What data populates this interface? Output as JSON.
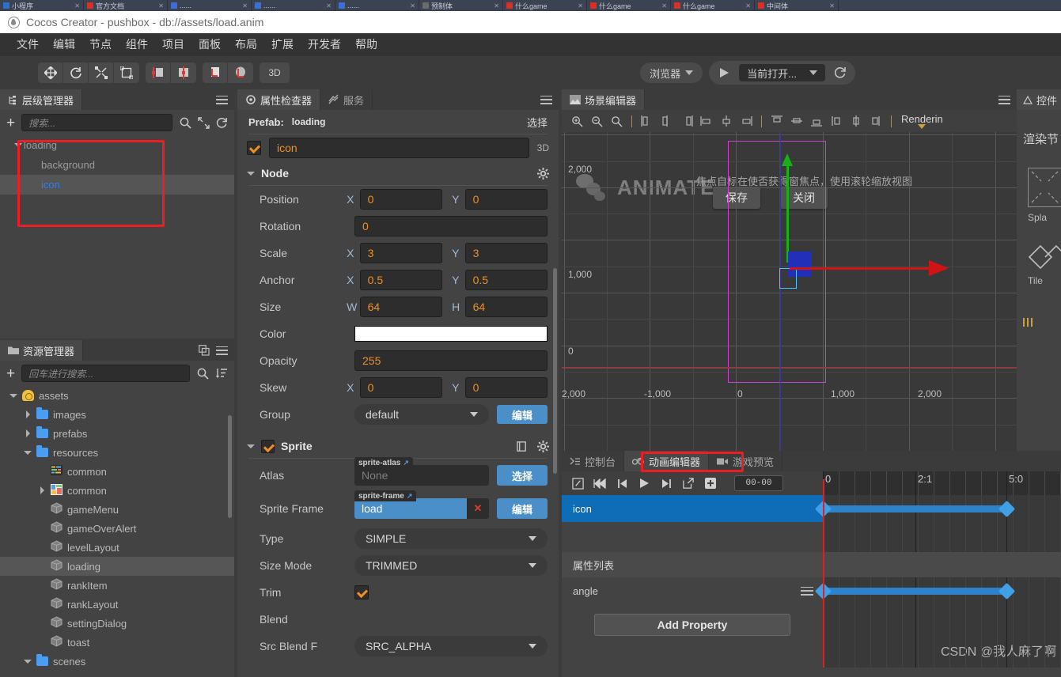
{
  "browser_tabs": [
    {
      "title": "小程序",
      "color": "#2f6fd0"
    },
    {
      "title": "官方文档",
      "color": "#d93025"
    },
    {
      "title": "......",
      "color": "#3b6fd4"
    },
    {
      "title": "......",
      "color": "#3b6fd4"
    },
    {
      "title": "......",
      "color": "#3b6fd4"
    },
    {
      "title": "预制体",
      "color": "#6b6b6b"
    },
    {
      "title": "什么game",
      "color": "#d93025"
    },
    {
      "title": "什么game",
      "color": "#d93025"
    },
    {
      "title": "什么game",
      "color": "#d93025"
    },
    {
      "title": "中间体",
      "color": "#d93025"
    }
  ],
  "window": {
    "logo_icon": "cocos-logo-icon",
    "title": "Cocos Creator - pushbox - db://assets/load.anim"
  },
  "menubar": {
    "items": [
      "文件",
      "编辑",
      "节点",
      "组件",
      "项目",
      "面板",
      "布局",
      "扩展",
      "开发者",
      "帮助"
    ]
  },
  "toolbar": {
    "transform_tools": [
      {
        "icon": "move-tool-icon",
        "name": "move"
      },
      {
        "icon": "rotate-tool-icon",
        "name": "rotate"
      },
      {
        "icon": "scale-tool-icon",
        "name": "scale"
      },
      {
        "icon": "rect-tool-icon",
        "name": "rect"
      }
    ],
    "pivot_tools": [
      {
        "icon": "pivot-center-icon",
        "name": "pivot-center"
      },
      {
        "icon": "pivot-pos-icon",
        "name": "pivot-pos"
      }
    ],
    "coord_tools": [
      {
        "icon": "local-coord-icon",
        "name": "local-coord"
      },
      {
        "icon": "global-coord-icon",
        "name": "global-coord"
      }
    ],
    "mode_3d_label": "3D",
    "browser_label": "浏览器",
    "play_icon": "play-icon",
    "scene_select_label": "当前打开...",
    "refresh_icon": "refresh-icon"
  },
  "hierarchy": {
    "tab_label": "层级管理器",
    "tab_icon": "hierarchy-icon",
    "add_icon": "plus-icon",
    "search_placeholder": "搜索...",
    "search_icon": "search-icon",
    "collapse_icon": "collapse-icon",
    "refresh_icon": "refresh-icon",
    "nodes": [
      {
        "label": "loading",
        "depth": 0,
        "expanded": true,
        "selected": false
      },
      {
        "label": "background",
        "depth": 1,
        "expanded": false,
        "selected": false
      },
      {
        "label": "icon",
        "depth": 1,
        "expanded": false,
        "selected": true
      }
    ]
  },
  "assets": {
    "tab_label": "资源管理器",
    "tab_icon": "assets-folder-icon",
    "copy_icon": "copy-icon",
    "add_icon": "plus-icon",
    "search_placeholder": "回车进行搜索...",
    "search_icon": "search-icon",
    "sort_icon": "sort-icon",
    "tree": [
      {
        "label": "assets",
        "depth": 0,
        "icon": "db-icon",
        "arrow": "down",
        "selected": false
      },
      {
        "label": "images",
        "depth": 1,
        "icon": "folder-icon",
        "arrow": "right",
        "selected": false
      },
      {
        "label": "prefabs",
        "depth": 1,
        "icon": "folder-icon",
        "arrow": "right",
        "selected": false
      },
      {
        "label": "resources",
        "depth": 1,
        "icon": "folder-icon",
        "arrow": "down",
        "selected": false
      },
      {
        "label": "common",
        "depth": 2,
        "icon": "script-icon",
        "arrow": "none",
        "selected": false
      },
      {
        "label": "common",
        "depth": 2,
        "icon": "image-icon",
        "arrow": "right",
        "selected": false
      },
      {
        "label": "gameMenu",
        "depth": 2,
        "icon": "prefab-icon",
        "arrow": "none",
        "selected": false
      },
      {
        "label": "gameOverAlert",
        "depth": 2,
        "icon": "prefab-icon",
        "arrow": "none",
        "selected": false
      },
      {
        "label": "levelLayout",
        "depth": 2,
        "icon": "prefab-icon",
        "arrow": "none",
        "selected": false
      },
      {
        "label": "loading",
        "depth": 2,
        "icon": "prefab-icon",
        "arrow": "none",
        "selected": true
      },
      {
        "label": "rankItem",
        "depth": 2,
        "icon": "prefab-icon",
        "arrow": "none",
        "selected": false
      },
      {
        "label": "rankLayout",
        "depth": 2,
        "icon": "prefab-icon",
        "arrow": "none",
        "selected": false
      },
      {
        "label": "settingDialog",
        "depth": 2,
        "icon": "prefab-icon",
        "arrow": "none",
        "selected": false
      },
      {
        "label": "toast",
        "depth": 2,
        "icon": "prefab-icon",
        "arrow": "none",
        "selected": false
      },
      {
        "label": "scenes",
        "depth": 1,
        "icon": "folder-icon",
        "arrow": "down",
        "selected": false
      }
    ]
  },
  "inspector": {
    "tabs": [
      {
        "label": "属性检查器",
        "icon": "inspector-gear-icon",
        "active": true
      },
      {
        "label": "服务",
        "icon": "service-icon",
        "active": false
      }
    ],
    "prefab_label": "Prefab:",
    "prefab_value": "loading",
    "prefab_action": "选择",
    "node_enabled": true,
    "node_name": "icon",
    "mode_3d": "3D",
    "node_section": {
      "title": "Node",
      "expanded": true,
      "gear_icon": "gear-icon",
      "rows": [
        {
          "label": "Position",
          "type": "xy",
          "x_axis": "X",
          "x": "0",
          "y_axis": "Y",
          "y": "0"
        },
        {
          "label": "Rotation",
          "type": "single",
          "value": "0"
        },
        {
          "label": "Scale",
          "type": "xy",
          "x_axis": "X",
          "x": "3",
          "y_axis": "Y",
          "y": "3"
        },
        {
          "label": "Anchor",
          "type": "xy",
          "x_axis": "X",
          "x": "0.5",
          "y_axis": "Y",
          "y": "0.5"
        },
        {
          "label": "Size",
          "type": "xy",
          "x_axis": "W",
          "x": "64",
          "y_axis": "H",
          "y": "64"
        },
        {
          "label": "Color",
          "type": "color",
          "value": "#ffffff"
        },
        {
          "label": "Opacity",
          "type": "single",
          "value": "255"
        },
        {
          "label": "Skew",
          "type": "xy",
          "x_axis": "X",
          "x": "0",
          "y_axis": "Y",
          "y": "0"
        },
        {
          "label": "Group",
          "type": "dropdown",
          "value": "default",
          "button": "编辑"
        }
      ]
    },
    "sprite_section": {
      "title": "Sprite",
      "enabled": true,
      "expanded": true,
      "help_icon": "book-icon",
      "gear_icon": "gear-icon",
      "rows": [
        {
          "label": "Atlas",
          "type": "asset",
          "tag": "sprite-atlas",
          "value": "None",
          "filled": false,
          "button": "选择"
        },
        {
          "label": "Sprite Frame",
          "type": "asset",
          "tag": "sprite-frame",
          "value": "load",
          "filled": true,
          "button": "编辑"
        },
        {
          "label": "Type",
          "type": "dropdown",
          "value": "SIMPLE"
        },
        {
          "label": "Size Mode",
          "type": "dropdown",
          "value": "TRIMMED"
        },
        {
          "label": "Trim",
          "type": "checkbox",
          "checked": true
        },
        {
          "label": "Blend",
          "type": "header"
        },
        {
          "label": "Src Blend F",
          "type": "dropdown",
          "value": "SRC_ALPHA"
        }
      ]
    }
  },
  "scene": {
    "tab_label": "场景编辑器",
    "tab_icon": "scene-icon",
    "toolbar_icons": [
      "zoom-in-icon",
      "zoom-out-icon",
      "zoom-reset-icon",
      "align-left-icon",
      "align-hcenter-icon",
      "align-right-icon",
      "dist-left-icon",
      "dist-hcenter-icon",
      "dist-right-icon",
      "align-top-icon",
      "align-vcenter-icon",
      "align-bottom-icon",
      "dist-top-icon",
      "dist-vcenter-icon",
      "dist-bottom-icon"
    ],
    "rendering_label": "Renderin",
    "hint_text": "焦点自标在使否获得窗焦点，使用滚轮缩放视图",
    "watermark": "ANIMATE",
    "save_button": "保存",
    "close_button": "关闭",
    "y_ticks": [
      "2,000",
      "1,000",
      "0"
    ],
    "x_ticks": [
      "2,000",
      "-1,000",
      "0",
      "1,000",
      "2,000"
    ],
    "gizmo": {
      "x_axis_color": "#d01414",
      "y_axis_color": "#18b018",
      "node_color": "#1f2fc8"
    }
  },
  "animation": {
    "tabs": [
      {
        "label": "控制台",
        "icon": "console-icon",
        "active": false,
        "highlight": false
      },
      {
        "label": "动画编辑器",
        "icon": "animation-icon",
        "active": true,
        "highlight": true
      },
      {
        "label": "游戏预览",
        "icon": "game-preview-icon",
        "active": false,
        "highlight": false
      }
    ],
    "toolbar_icons": [
      "edit-mode-icon",
      "jump-start-icon",
      "prev-frame-icon",
      "play-icon",
      "next-frame-icon",
      "open-external-icon",
      "add-keyframe-icon"
    ],
    "frame_display": "00-00",
    "ruler_labels": [
      {
        "text": "0",
        "pos": 0
      },
      {
        "text": "2:1",
        "pos": 0.39
      },
      {
        "text": "5:0",
        "pos": 0.77
      }
    ],
    "track_name": "icon",
    "property_list_label": "属性列表",
    "property_name": "angle",
    "property_menu_icon": "drag-handle-icon",
    "add_property_button": "Add Property",
    "watermark": "CSDN @我人麻了啊"
  },
  "right_rail": {
    "tab_label": "控件",
    "tab_icon": "widget-icon",
    "section_title": "渲染节",
    "items": [
      {
        "label": "Spla",
        "icon": "splash-icon"
      },
      {
        "label": "Tile",
        "icon": "tilemap-icon"
      }
    ]
  }
}
